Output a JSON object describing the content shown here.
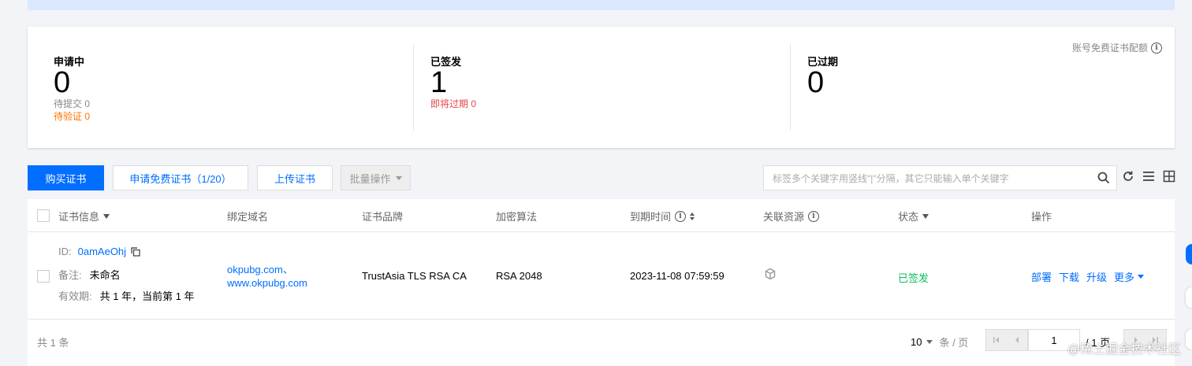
{
  "stats": {
    "applying": {
      "title": "申请中",
      "count": "0",
      "sub1": "待提交 0",
      "sub2": "待验证 0"
    },
    "issued": {
      "title": "已签发",
      "count": "1",
      "sub1": "即将过期 0"
    },
    "expired": {
      "title": "已过期",
      "count": "0"
    },
    "quota_label": "账号免费证书配额"
  },
  "toolbar": {
    "buy_label": "购买证书",
    "apply_free_label": "申请免费证书（1/20）",
    "upload_label": "上传证书",
    "batch_label": "批量操作",
    "search_placeholder": "标签多个关键字用竖线\"|\"分隔，其它只能输入单个关键字"
  },
  "table": {
    "columns": [
      "证书信息",
      "绑定域名",
      "证书品牌",
      "加密算法",
      "到期时间",
      "关联资源",
      "状态",
      "操作"
    ],
    "rows": [
      {
        "id_label": "ID:",
        "id": "0amAeOhj",
        "remark_label": "备注:",
        "remark": "未命名",
        "validity_label": "有效期:",
        "validity": "共 1 年，当前第 1 年",
        "domain1": "okpubg.com、",
        "domain2": "www.okpubg.com",
        "brand": "TrustAsia TLS RSA CA",
        "algorithm": "RSA 2048",
        "expire": "2023-11-08 07:59:59",
        "status": "已签发",
        "actions": [
          "部署",
          "下载",
          "升级",
          "更多"
        ]
      }
    ]
  },
  "footer": {
    "total": "共 1 条",
    "page_size": "10",
    "per_page_label": "条 / 页",
    "current_page": "1",
    "total_pages": "/ 1 页"
  },
  "watermark": "@稀土掘金技术社区",
  "colors": {
    "primary": "#006eff",
    "success": "#0abf5b",
    "warning": "#ff7200",
    "danger": "#e54545"
  }
}
